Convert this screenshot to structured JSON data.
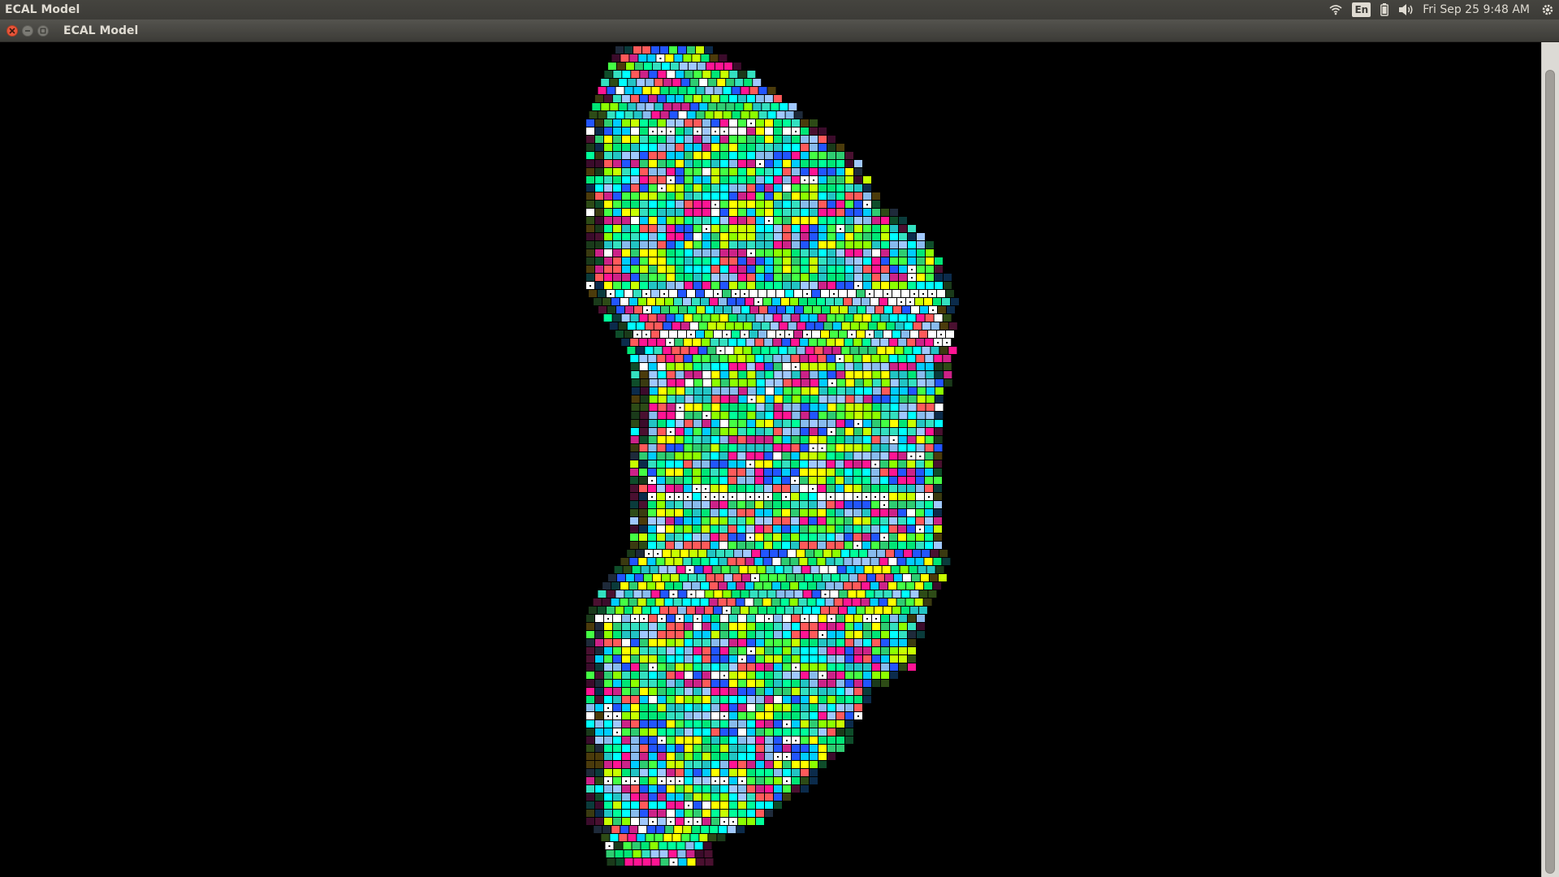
{
  "panel": {
    "app_title": "ECAL Model",
    "language": "En",
    "clock": "Fri Sep 25  9:48 AM",
    "icons": [
      "wifi-icon",
      "keyboard-language-icon",
      "battery-icon",
      "volume-icon",
      "settings-gear-icon"
    ]
  },
  "window": {
    "title": "ECAL Model",
    "buttons": [
      "close",
      "minimize",
      "maximize"
    ]
  },
  "colors": {
    "background": "#000000",
    "panel": "#3c3b37",
    "close_button": "#e8553a",
    "palette": [
      "#ffff00",
      "#c8ff00",
      "#8cff00",
      "#00e676",
      "#00ff99",
      "#33e0c0",
      "#22c4c4",
      "#00ffff",
      "#a0c8ff",
      "#88bbee",
      "#ff5a5a",
      "#ff1493",
      "#cc2288",
      "#2255ff",
      "#ffffff",
      "#00ccff",
      "#44ff44",
      "#2ecc71"
    ],
    "edge_palette": [
      "#1a3a1a",
      "#0e4d2a",
      "#3a3a10",
      "#4a1030",
      "#1e2a3a",
      "#2d4b16",
      "#0a3b3b",
      "#3b0b2b",
      "#4b3b0b",
      "#0b2b4b"
    ]
  },
  "visualization": {
    "type": "ecal-endcap-crystal-map"
  }
}
